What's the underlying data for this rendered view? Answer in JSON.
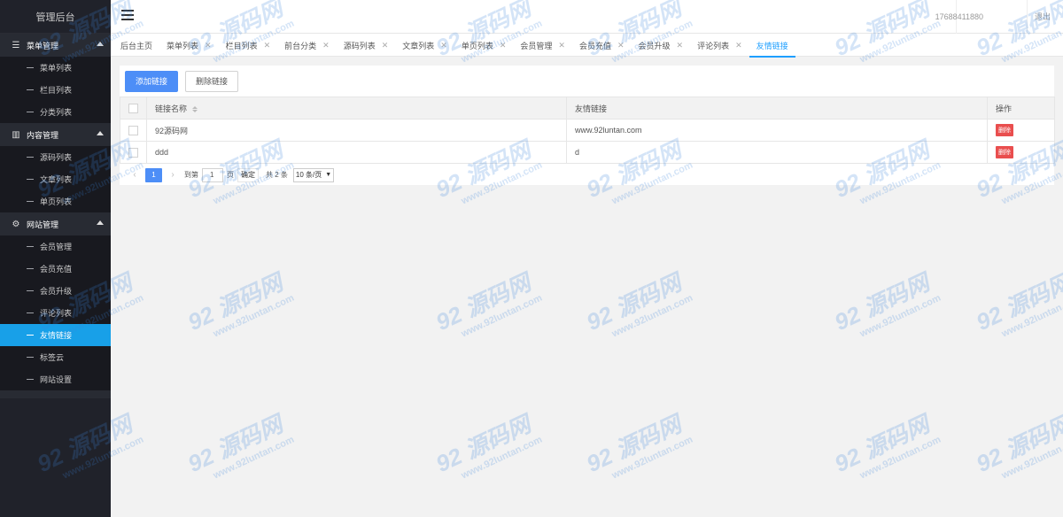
{
  "app": {
    "title": "管理后台"
  },
  "header": {
    "user": "17688411880",
    "logout": "退出"
  },
  "sidebar": {
    "groups": [
      {
        "title": "菜单管理",
        "icon": "menu-icon",
        "items": [
          "菜单列表",
          "栏目列表",
          "分类列表"
        ]
      },
      {
        "title": "内容管理",
        "icon": "book-icon",
        "items": [
          "源码列表",
          "文章列表",
          "单页列表"
        ]
      },
      {
        "title": "网站管理",
        "icon": "gear-icon",
        "items": [
          "会员管理",
          "会员充值",
          "会员升级",
          "评论列表",
          "友情链接",
          "标签云",
          "网站设置"
        ]
      }
    ],
    "active_item": "友情链接"
  },
  "tabs": [
    {
      "label": "后台主页",
      "closable": false
    },
    {
      "label": "菜单列表",
      "closable": true
    },
    {
      "label": "栏目列表",
      "closable": true
    },
    {
      "label": "前台分类",
      "closable": true
    },
    {
      "label": "源码列表",
      "closable": true
    },
    {
      "label": "文章列表",
      "closable": true
    },
    {
      "label": "单页列表",
      "closable": true
    },
    {
      "label": "会员管理",
      "closable": true
    },
    {
      "label": "会员充值",
      "closable": true
    },
    {
      "label": "会员升级",
      "closable": true
    },
    {
      "label": "评论列表",
      "closable": true
    },
    {
      "label": "友情链接",
      "closable": true,
      "active": true
    }
  ],
  "toolbar": {
    "add_label": "添加链接",
    "delete_label": "删除链接"
  },
  "table": {
    "columns": [
      "链接名称",
      "友情链接",
      "操作"
    ],
    "rows": [
      {
        "name": "92源码网",
        "url": "www.92luntan.com",
        "action": "删除"
      },
      {
        "name": "ddd",
        "url": "d",
        "action": "删除"
      }
    ]
  },
  "pager": {
    "prev": "‹",
    "current": "1",
    "next": "›",
    "goto_label": "到第",
    "page_input": "1",
    "page_unit": "页",
    "confirm": "确定",
    "total": "共 2 条",
    "page_size": "10 条/页"
  },
  "watermark": {
    "logo": "92 源码网",
    "url": "www.92luntan.com"
  },
  "colors": {
    "sidebar_bg": "#20222a",
    "active": "#18a0e8",
    "primary_btn": "#4d8ef7",
    "danger": "#e94e4e",
    "tab_active": "#1e9fff"
  }
}
